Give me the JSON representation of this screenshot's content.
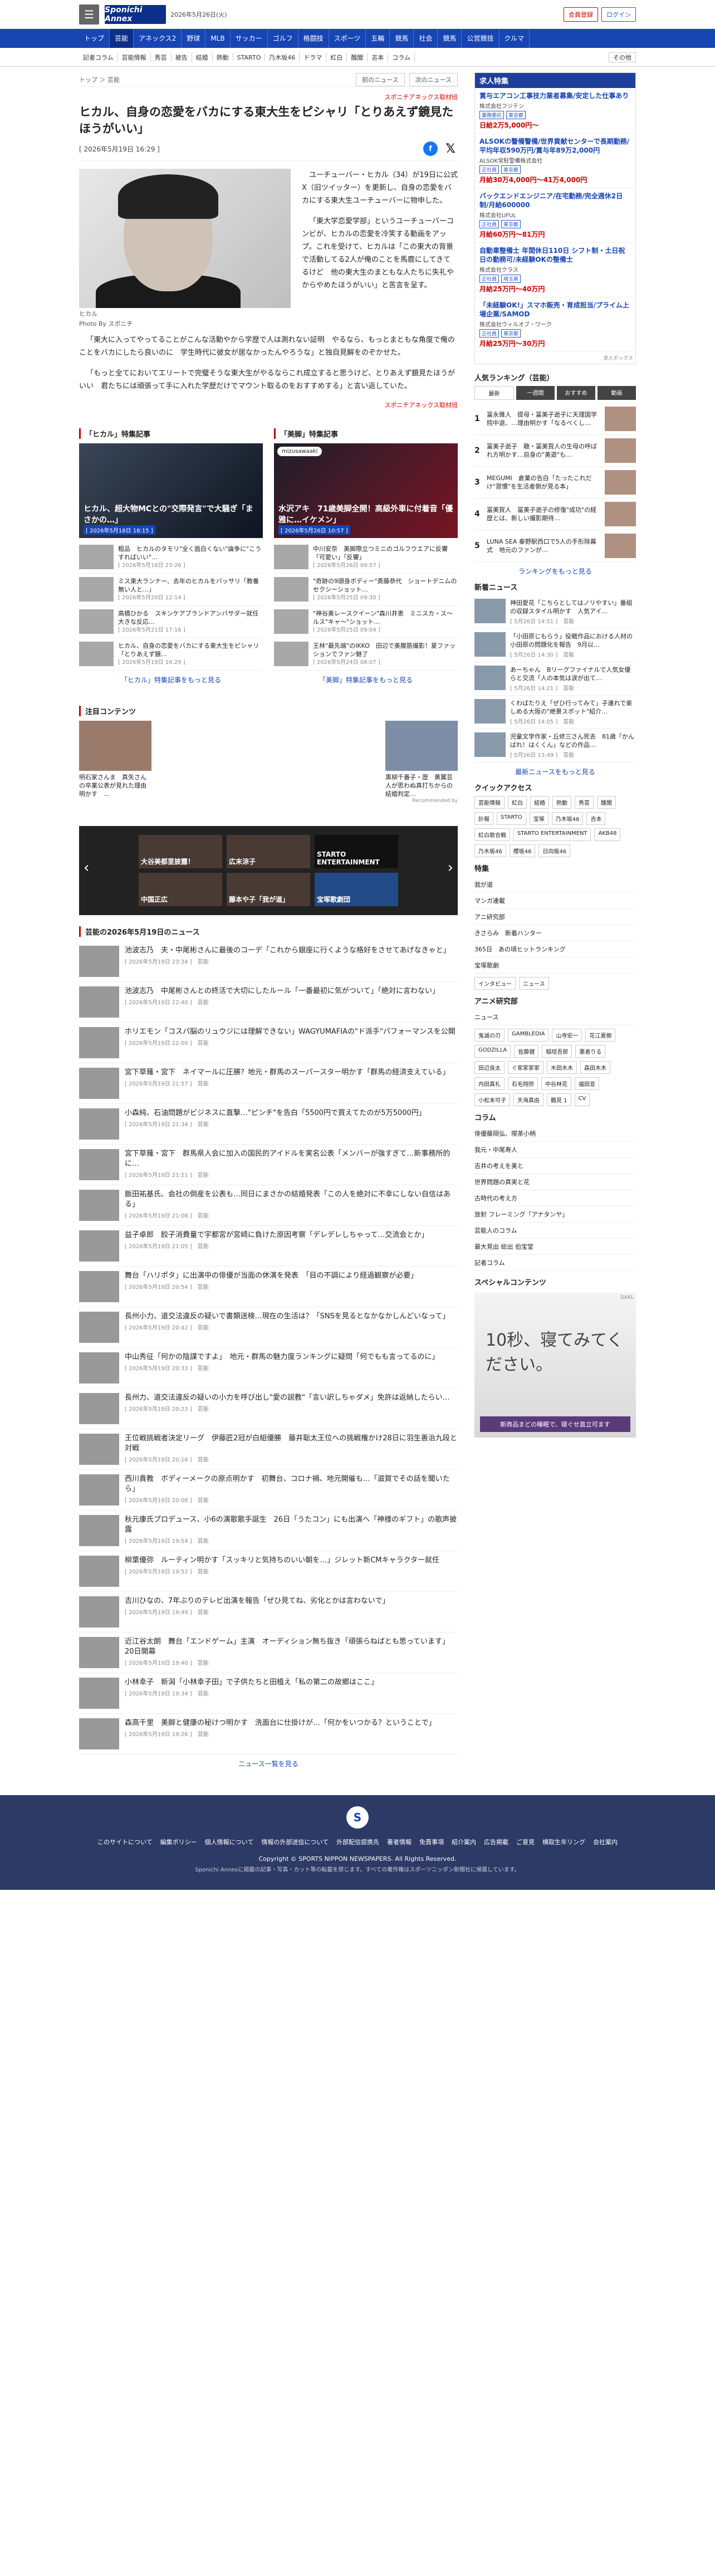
{
  "header": {
    "logo": "Sponichi Annex",
    "date": "2026年5月26日(火)",
    "btn1": "会員登録",
    "btn2": "ログイン"
  },
  "nav": [
    "トップ",
    "芸能",
    "アネックス2",
    "野球",
    "MLB",
    "サッカー",
    "ゴルフ",
    "格闘技",
    "スポーツ",
    "五輪",
    "競馬",
    "社会",
    "競馬",
    "公営競技",
    "クルマ"
  ],
  "subnav": [
    "記者コラム",
    "芸能情報",
    "秀芸",
    "被告",
    "結婚",
    "熱動",
    "STARTO",
    "乃木坂46",
    "ドラマ",
    "紅白",
    "醜聞",
    "吉本",
    "コラム"
  ],
  "subnav_more": "その他",
  "crumb": "トップ ＞ 芸能",
  "prev": "前のニュース",
  "next": "次のニュース",
  "article": {
    "kicker": "スポニチアネックス取材班",
    "title": "ヒカル、自身の恋愛をバカにする東大生をピシャリ「とりあえず鏡見たほうがいい」",
    "date": "[ 2026年5月19日 16:29 ]",
    "caption": "ヒカル",
    "photo_by": "Photo By スポニチ",
    "p1": "ユーチューバー・ヒカル（34）が19日に公式X（旧ツイッター）を更新し、自身の恋愛をバカにする東大生ユーチューバーに物申した。",
    "p2": "「東大学恋愛学部」というユーチューバーコンビが、ヒカルの恋愛を冷笑する動画をアップ。これを受けて、ヒカルは「この東大の背景で活動してる2人が俺のことを馬鹿にしてきてるけど　他の東大生のまともな人たちに失礼やからやめたほうがいい」と苦言を呈す。",
    "p3": "「東大に入ってやってることがこんな活動やから学歴で人は測れない証明　やるなら、もっとまともな角度で俺のことをバカにしたら良いのに　学生時代に彼女が居なかったんやろうな」と独自見解をのぞかせた。",
    "p4": "「もっと全てにおいてエリートで完璧そうな東大生がやるならこれ成立すると思うけど、とりあえず鏡見たほうがいい　君たちには頑張って手に入れた学歴だけでマウント取るのをおすすめする」と言い返していた。",
    "source": "スポニチアネックス取材班"
  },
  "feat": {
    "left_title": "「ヒカル」特集記事",
    "right_title": "「美脚」特集記事",
    "left_big": "ヒカル、超大物MCとの\"交際発言\"で大騒ぎ「まさかの…」",
    "left_big_date": "[ 2026年5月18日 18:15 ]",
    "right_badge": "mizusawaaki",
    "right_big": "水沢アキ　71歳美脚全開！高級外車に付着音「優雅に…イケメン」",
    "right_big_date": "[ 2026年5月26日 10:57 ]",
    "left": [
      {
        "t": "粗品　ヒカルのタモリ\"全く面白くない\"論争に\"こうすればいい\"…",
        "d": "[ 2026年5月18日 23:26 ]"
      },
      {
        "t": "ミス東大ランナー、去年のヒカルをバッサリ「教養無い人と…」",
        "d": "[ 2026年5月20日 12:14 ]"
      },
      {
        "t": "高橋ひかる　スキンケアブランドアンバサダー就任　大きな反応…",
        "d": "[ 2026年5月21日 17:16 ]"
      },
      {
        "t": "ヒカル、自身の恋愛をバカにする東大生をピシャリ「とりあえず鏡…",
        "d": "[ 2026年5月19日 16:29 ]"
      }
    ],
    "right": [
      {
        "t": "中川安奈　美脚際立つミニのゴルフウエアに反響「可愛い」「反響」",
        "d": "[ 2026年5月26日 09:57 ]"
      },
      {
        "t": "\"奇跡の9頭身ボディー\"斎藤恭代　ショートデニムのセクシーショット…",
        "d": "[ 2026年5月25日 09:30 ]"
      },
      {
        "t": "\"神谷美レースクイーン\"森川井恵　ミニスカ・ス〜ルス\"キャ〜\"ショット…",
        "d": "[ 2026年5月25日 09:04 ]"
      },
      {
        "t": "王林\"最先端\"のIKKO　田辺で美腹筋撮影！夏ファッションでファン魅了",
        "d": "[ 2026年5月24日 08:07 ]"
      }
    ],
    "left_more": "「ヒカル」特集記事をもっと見る",
    "right_more": "「美脚」特集記事をもっと見る"
  },
  "attention": {
    "title": "注目コンテンツ",
    "left": "明石家さんま　真矢さんの卒業公表が見れた理由明かす　…",
    "right": "黒柳千番子・歴　黄翼芸人が思わぬ真打ちからの結婚判定…",
    "pr": "Recommended by"
  },
  "carousel": [
    "大谷美都里披露！",
    "広末涼子",
    "STARTO ENTERTAINMENT",
    "中国正広",
    "藤本や子「我が道」",
    "宝塚歌劇団"
  ],
  "newslist": {
    "title": "芸能の2026年5月19日のニュース",
    "more": "ニュース一覧を見る",
    "items": [
      {
        "t": "池波志乃　夫・中尾彬さんに最後のコーデ「これから銀座に行くような格好をさせてあげなきゃと」",
        "d": "[ 2026年5月19日 23:34 ]　芸能"
      },
      {
        "t": "池波志乃　中尾彬さんとの終活で大切にしたルール「一番最初に気がついて」「絶対に言わない」",
        "d": "[ 2026年5月19日 22:40 ]　芸能"
      },
      {
        "t": "ホリエモン「コスパ脳のリュウジには理解できない」WAGYUMAFIAの\"ド派手\"パフォーマンスを公開",
        "d": "[ 2026年5月19日 22:00 ]　芸能"
      },
      {
        "t": "宮下草薙・宮下　ネイマールに圧勝？地元・群馬のスーパースター明かす「群馬の経済支えている」",
        "d": "[ 2026年5月19日 21:57 ]　芸能"
      },
      {
        "t": "小森純、石油問題がビジネスに直撃…\"ピンチ\"を告白「5500円で買えてたのが5万5000円」",
        "d": "[ 2026年5月19日 21:34 ]　芸能"
      },
      {
        "t": "宮下草薙・宮下　群馬県人会に加入の国民的アイドルを実名公表「メンバーが強すぎて…新事務所的に…",
        "d": "[ 2026年5月19日 21:21 ]　芸能"
      },
      {
        "t": "飯田祐基氏、会社の倒産を公表も…同日にまさかの結婚発表「この人を絶対に不幸にしない自信はある」",
        "d": "[ 2026年5月19日 21:08 ]　芸能"
      },
      {
        "t": "益子卓郎　餃子消費量で宇都宮が宮崎に負けた原因考察「デレデレしちゃって…交流会とか」",
        "d": "[ 2026年5月19日 21:05 ]　芸能"
      },
      {
        "t": "舞台「ハリポタ」に出演中の俳優が当面の休演を発表　「目の不調により経過観察が必要」",
        "d": "[ 2026年5月19日 20:54 ]　芸能"
      },
      {
        "t": "長州小力、道交法違反の疑いで書類送検…現在の生活は？「SNSを見るとなかなかしんどいなって」",
        "d": "[ 2026年5月19日 20:42 ]　芸能"
      },
      {
        "t": "中山秀征「何かの陰謀ですよ」　地元・群馬の魅力度ランキングに疑問「何でもも言ってるのに」",
        "d": "[ 2026年5月19日 20:33 ]　芸能"
      },
      {
        "t": "長州力、道交法違反の疑いの小力を呼び出し\"愛の説教\"「言い訳しちゃダメ」免許は返納したらい…",
        "d": "[ 2026年5月19日 20:23 ]　芸能"
      },
      {
        "t": "王位戦挑戦者決定リーグ　伊藤匠2冠が白組優勝　藤井聡太王位への挑戦権かけ28日に羽生善治九段と対戦",
        "d": "[ 2026年5月19日 20:16 ]　芸能"
      },
      {
        "t": "西川貴教　ボディーメークの原点明かす　初舞台、コロナ禍、地元開催も…「滋賀でその話を聞いたら」",
        "d": "[ 2026年5月19日 20:08 ]　芸能"
      },
      {
        "t": "秋元康氏プロデュース、小6の演歌歌手誕生　26日「うたコン」にも出演へ「神様のギフト」の歌声披露",
        "d": "[ 2026年5月19日 19:54 ]　芸能"
      },
      {
        "t": "柳葉優弥　ルーティン明かす「スッキリと気持ちのいい朝を…」ジレット新CMキャラクター就任",
        "d": "[ 2026年5月19日 19:52 ]　芸能"
      },
      {
        "t": "吉川ひなの、7年ぶりのテレビ出演を報告「ぜひ見てね、劣化とかは言わないで」",
        "d": "[ 2026年5月19日 19:49 ]　芸能"
      },
      {
        "t": "近江谷太朗　舞台「エンドゲーム」主演　オーディション無ち抜き「頑張らねばとも思っています」20日開幕",
        "d": "[ 2026年5月19日 19:40 ]　芸能"
      },
      {
        "t": "小林幸子　新潟「小林幸子田」で子供たちと田植え「私の第二の故郷はここ」",
        "d": "[ 2026年5月19日 19:34 ]　芸能"
      },
      {
        "t": "森高千里　美脚と健康の秘けつ明かす　洗面台に仕掛けが…「何かをいつかる？ということで」",
        "d": "[ 2026年5月19日 19:26 ]　芸能"
      }
    ]
  },
  "side": {
    "jobs_title": "求人特集",
    "jobs": [
      {
        "t": "賞与エアコン工事技力業者募集/安定した仕事あり",
        "c": "株式会社フジテン",
        "tags": [
          "業務委託",
          "東京都"
        ],
        "p": "日給2万5,000円〜"
      },
      {
        "t": "ALSOKの警備警備/世界貢献センターで長期勤務/平均年収590万円/賞与年89万2,000円",
        "c": "ALSOK常駐警備株式会社",
        "tags": [
          "正社員",
          "東京都"
        ],
        "p": "月給30万4,000円〜41万4,000円"
      },
      {
        "t": "バックエンドエンジニア/在宅勤務/完全週休2日制/月給600000",
        "c": "株式会社UFUL",
        "tags": [
          "正社員",
          "東京都"
        ],
        "p": "月給60万円〜81万円"
      },
      {
        "t": "自動車整備士 年間休日110日 シフト制・土日祝日の勤務可/未経験OKの整備士",
        "c": "株式会社クラス",
        "tags": [
          "正社員",
          "埼玉県"
        ],
        "p": "月給25万円〜40万円"
      },
      {
        "t": "「未経験OK!」スマホ販売・育成担当/プライム上場企業/SAMOD",
        "c": "株式会社ウィルオブ・ワーク",
        "tags": [
          "正社員",
          "東京都"
        ],
        "p": "月給25万円〜30万円"
      }
    ],
    "jobs_src": "求人ボックス",
    "rank_title": "人気ランキング（芸能）",
    "rank_tabs": [
      "最新",
      "一週間",
      "おすすめ",
      "動画"
    ],
    "rank": [
      {
        "n": "1",
        "t": "冨永雅人　提母・冨美子逝子に天理国学院中退、…理由明かす「なるべくし…"
      },
      {
        "n": "2",
        "t": "冨美子逝子　聴・冨美賀人の生母の呼ばれ方明かす…自身の\"美遊\"も…"
      },
      {
        "n": "3",
        "t": "MEGUMI　倉業の告白「たったこれだけ\"習慣\"を生活者側が見る本」"
      },
      {
        "n": "4",
        "t": "冨美賀人　冨美子逝子の修復\"成功\"の経歴とは、新しい撮影期待…"
      },
      {
        "n": "5",
        "t": "LUNA SEA 秦野駅西口で5人の手形除幕式　地元のファンが…"
      }
    ],
    "rank_more": "ランキングをもっと見る",
    "newnews_title": "新着ニュース",
    "newnews": [
      {
        "t": "神田愛花「こちらとしてはノリやすい」番組の収録スタイル明かす　人気アイ…",
        "d": "[ 5月26日 14:51 ]　芸能"
      },
      {
        "t": "「小田原じもらう」役戦作品における人材の小田原の問題化を報告　9月以…",
        "d": "[ 5月26日 14:30 ]　芸能"
      },
      {
        "t": "あーちゃん　Bリーグファイナルで人気女優らと交流「人の本気は涙が出て…",
        "d": "[ 5月26日 14:21 ]　芸能"
      },
      {
        "t": "くわばたりえ「ぜひ行ってみて」子連れで楽しめる大阪の\"絶景スポット\"紹介…",
        "d": "[ 5月26日 14:05 ]　芸能"
      },
      {
        "t": "児童文学作家・丘修三さん死去　81歳「かんばれ！はくくん」などの作品…",
        "d": "[ 5月26日 13:49 ]　芸能"
      }
    ],
    "newnews_more": "最新ニュースをもっと見る",
    "qa_title": "クイックアクセス",
    "qa": [
      "芸能情報",
      "紅白",
      "結婚",
      "熱動",
      "秀芸",
      "醜聞",
      "訃報",
      "STARTO",
      "宝塚",
      "乃木坂46",
      "吉本",
      "紅白歌合戦",
      "STARTO ENTERTAINMENT",
      "AKB48",
      "乃木坂46",
      "櫻坂46",
      "日向坂46"
    ],
    "tokusyu_title": "特集",
    "tokusyu": [
      "我が道",
      "マンガ連載",
      "アニ研究部",
      "きさらみ　新着ハンター",
      "365日　あの頃ヒットランキング",
      "宝塚歌劇"
    ],
    "tokusyu_tabs": [
      "インタビュー",
      "ニュース"
    ],
    "anime_title": "アニメ研究部",
    "anime_tab": "ニュース",
    "anime_links": [
      "鬼滅の刃",
      "GAMBLEDIA",
      "山寺宏一",
      "花江夏樹",
      "GODZILLA",
      "佐藤健",
      "稲垣吾郎",
      "悪者りる",
      "田辺良太",
      "ぐ家家家家",
      "木田木木",
      "森田木木",
      "内田真礼",
      "石毛翔弥",
      "中谷林花",
      "福田宣",
      "小松未可子",
      "天海真由",
      "鶴見 1",
      "CV"
    ],
    "column_title": "コラム",
    "columns": [
      "俳優藤岡弘、喫茶小柄",
      "我元・中尾寿人",
      "吉井の考えを美と",
      "世界問題の真実と花",
      "古時代の考え方",
      "放射 フレーミング「アナタンヤ」",
      "芸能人のコラム",
      "最大見出 総出  伯宝堂",
      "記者コラム"
    ],
    "sp_title": "スペシャルコンテンツ",
    "ad_text": "10秒、寝てみてください。",
    "ad_brand": "DAKL",
    "ad_bottom": "新商品まどの睡眠で、寝ぐせ直立可ます"
  },
  "footer": {
    "links": [
      "このサイトについて",
      "編集ポリシー",
      "個人情報について",
      "情報の外部送信について",
      "外部配信提携先",
      "著者情報",
      "免責事項",
      "紹介案内",
      "広告掲載",
      "ご意見",
      "横取生年リング",
      "会社案内"
    ],
    "copy": "Copyright © SPORTS NIPPON NEWSPAPERS. All Rights Reserved.",
    "copy2": "Sponichi Annexに掲載の記事・写真・カット等の転載を禁じます。すべての著作権はスポーツニッポン新聞社に帰属しています。"
  }
}
